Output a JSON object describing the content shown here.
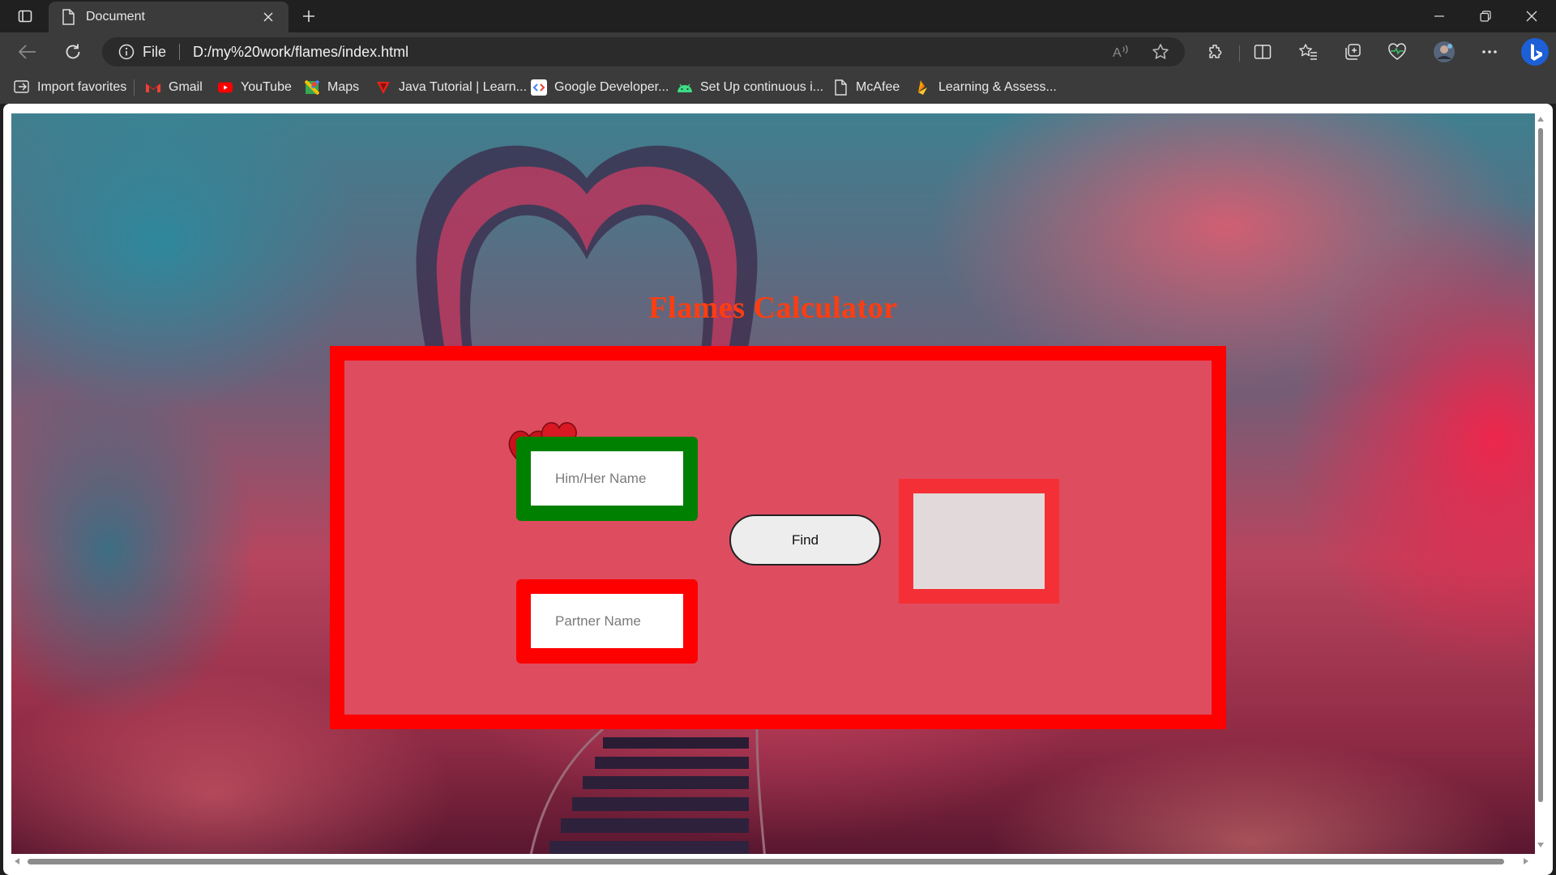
{
  "browser": {
    "tab": {
      "title": "Document"
    },
    "address": {
      "scheme": "File",
      "url": "D:/my%20work/flames/index.html"
    },
    "favorites": [
      {
        "label": "Import favorites",
        "icon": "import-icon"
      },
      {
        "label": "Gmail",
        "icon": "gmail-icon"
      },
      {
        "label": "YouTube",
        "icon": "youtube-icon"
      },
      {
        "label": "Maps",
        "icon": "maps-icon"
      },
      {
        "label": "Java Tutorial | Learn...",
        "icon": "javatpoint-icon"
      },
      {
        "label": "Google Developer...",
        "icon": "google-developers-icon"
      },
      {
        "label": "Set Up continuous i...",
        "icon": "android-icon"
      },
      {
        "label": "McAfee",
        "icon": "page-icon"
      },
      {
        "label": "Learning & Assess...",
        "icon": "firebase-icon"
      }
    ]
  },
  "page": {
    "title": "Flames Calculator",
    "form": {
      "first_name_placeholder": "Him/Her Name",
      "partner_name_placeholder": "Partner Name",
      "find_label": "Find",
      "result": ""
    }
  },
  "colors": {
    "title": "#ff3d10",
    "card_border": "#ff0000",
    "card_bg": "#de4c60",
    "first_box": "#008000",
    "second_box": "#ff0000",
    "result_border": "#f43036",
    "result_bg": "#e2dada"
  }
}
